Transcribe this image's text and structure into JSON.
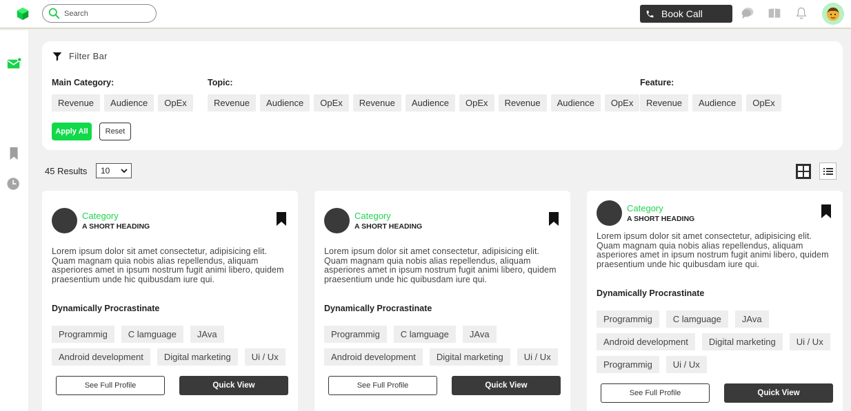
{
  "colors": {
    "accent": "#11d94a",
    "dark": "#333333",
    "chip_bg": "#eeeeee"
  },
  "topbar": {
    "search_placeholder": "Search",
    "book_call_label": "Book Call",
    "icons": [
      "logo-cube-icon",
      "search-icon",
      "phone-icon",
      "chat-bubble-icon",
      "book-icon",
      "bell-icon",
      "user-avatar-icon"
    ]
  },
  "sidebar": {
    "icons": [
      "mail-icon",
      "bookmark-icon",
      "clock-icon"
    ]
  },
  "filter": {
    "title": "Filter Bar",
    "main_category": {
      "label": "Main Category:",
      "chips": [
        "Revenue",
        "Audience",
        "OpEx"
      ]
    },
    "topic": {
      "label": "Topic:",
      "chips": [
        "Revenue",
        "Audience",
        "OpEx",
        "Revenue",
        "Audience",
        "OpEx",
        "Revenue",
        "Audience",
        "OpEx"
      ]
    },
    "feature": {
      "label": "Feature:",
      "chips": [
        "Revenue",
        "Audience",
        "OpEx"
      ]
    },
    "apply_label": "Apply All",
    "reset_label": "Reset"
  },
  "results": {
    "count_label": "45 Results",
    "per_page": "10"
  },
  "cards": [
    {
      "category": "Category",
      "heading": "A SHORT HEADING",
      "body": "Lorem ipsum dolor sit amet consectetur, adipisicing elit. Quam magnam quia nobis alias repellendus, aliquam asperiores amet in ipsum nostrum fugit animi libero, quidem praesentium unde hic quibusdam iure qui.",
      "subheading": "Dynamically Procrastinate",
      "tag_rows": [
        [
          "Programmig",
          "C lamguage",
          "JAva"
        ],
        [
          "Android development",
          "Digital marketing",
          "Ui / Ux"
        ]
      ],
      "profile_label": "See Full Profile",
      "quick_label": "Quick View"
    },
    {
      "category": "Category",
      "heading": "A SHORT HEADING",
      "body": "Lorem ipsum dolor sit amet consectetur, adipisicing elit. Quam magnam quia nobis alias repellendus, aliquam asperiores amet in ipsum nostrum fugit animi libero, quidem praesentium unde hic quibusdam iure qui.",
      "subheading": "Dynamically Procrastinate",
      "tag_rows": [
        [
          "Programmig",
          "C lamguage",
          "JAva"
        ],
        [
          "Android development",
          "Digital marketing",
          "Ui / Ux"
        ]
      ],
      "profile_label": "See Full Profile",
      "quick_label": "Quick View"
    },
    {
      "category": "Category",
      "heading": "A SHORT HEADING",
      "body": "Lorem ipsum dolor sit amet consectetur, adipisicing elit. Quam magnam quia nobis alias repellendus, aliquam asperiores amet in ipsum nostrum fugit animi libero, quidem praesentium unde hic quibusdam iure qui.",
      "subheading": "Dynamically Procrastinate",
      "tag_rows": [
        [
          "Programmig",
          "C lamguage",
          "JAva"
        ],
        [
          "Android development",
          "Digital marketing",
          "Ui / Ux"
        ],
        [
          "Programmig",
          "Ui / Ux"
        ]
      ],
      "profile_label": "See Full Profile",
      "quick_label": "Quick View"
    }
  ]
}
